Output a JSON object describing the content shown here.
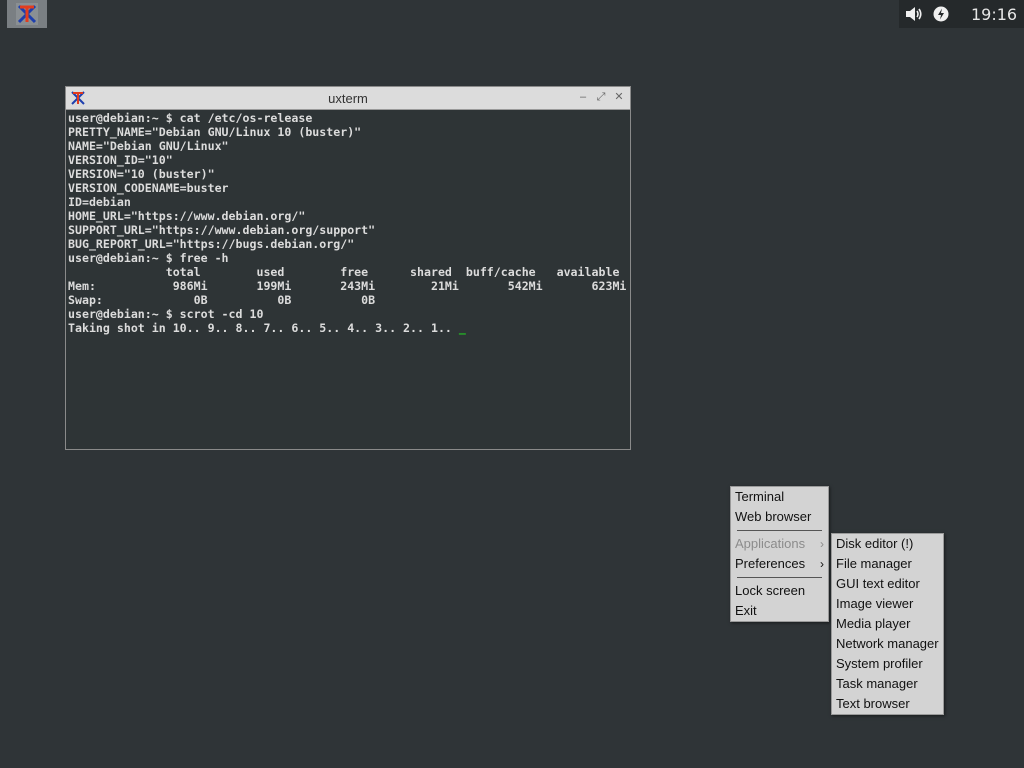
{
  "panel": {
    "clock": "19:16",
    "launcher_icon": "xterm-icon",
    "tray_icons": [
      "volume-icon",
      "power-icon"
    ]
  },
  "window": {
    "title": "uxterm",
    "buttons": {
      "minimize": "‒",
      "maximize": "⤢",
      "close": "✕"
    },
    "terminal_lines": [
      "user@debian:~ $ cat /etc/os-release",
      "PRETTY_NAME=\"Debian GNU/Linux 10 (buster)\"",
      "NAME=\"Debian GNU/Linux\"",
      "VERSION_ID=\"10\"",
      "VERSION=\"10 (buster)\"",
      "VERSION_CODENAME=buster",
      "ID=debian",
      "HOME_URL=\"https://www.debian.org/\"",
      "SUPPORT_URL=\"https://www.debian.org/support\"",
      "BUG_REPORT_URL=\"https://bugs.debian.org/\"",
      "user@debian:~ $ free -h",
      "              total        used        free      shared  buff/cache   available",
      "Mem:           986Mi       199Mi       243Mi        21Mi       542Mi       623Mi",
      "Swap:             0B          0B          0B",
      "user@debian:~ $ scrot -cd 10",
      "Taking shot in 10.. 9.. 8.. 7.. 6.. 5.. 4.. 3.. 2.. 1.. "
    ],
    "cursor": "_"
  },
  "menu": {
    "terminal": "Terminal",
    "web_browser": "Web browser",
    "applications": "Applications",
    "preferences": "Preferences",
    "lock_screen": "Lock screen",
    "exit": "Exit",
    "arrow": "›"
  },
  "submenu": {
    "items": [
      "Disk editor (!)",
      "File manager",
      "GUI text editor",
      "Image viewer",
      "Media player",
      "Network manager",
      "System profiler",
      "Task manager",
      "Text browser"
    ]
  }
}
